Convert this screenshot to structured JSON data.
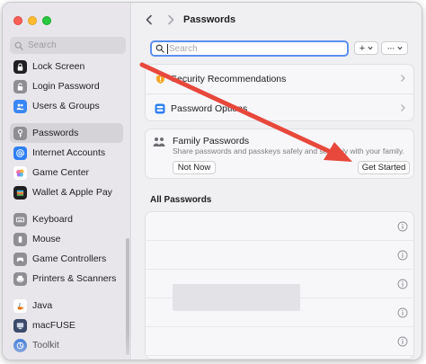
{
  "sidebar": {
    "search_placeholder": "Search",
    "items": [
      {
        "label": "Lock Screen",
        "icon": "lock-icon",
        "color": "#1f1f22"
      },
      {
        "label": "Login Password",
        "icon": "login-password-icon",
        "color": "#8e8e93"
      },
      {
        "label": "Users & Groups",
        "icon": "users-groups-icon",
        "color": "#3a86f5"
      },
      {
        "label": "Passwords",
        "icon": "key-icon",
        "color": "#8e8e93",
        "selected": true
      },
      {
        "label": "Internet Accounts",
        "icon": "at-sign-icon",
        "color": "#2f7ff5"
      },
      {
        "label": "Game Center",
        "icon": "game-center-icon",
        "color": "#f25c9a"
      },
      {
        "label": "Wallet & Apple Pay",
        "icon": "wallet-icon",
        "color": "#1f1f22"
      },
      {
        "label": "Keyboard",
        "icon": "keyboard-icon",
        "color": "#8e8e93"
      },
      {
        "label": "Mouse",
        "icon": "mouse-icon",
        "color": "#8e8e93"
      },
      {
        "label": "Game Controllers",
        "icon": "game-controller-icon",
        "color": "#8e8e93"
      },
      {
        "label": "Printers & Scanners",
        "icon": "printer-icon",
        "color": "#8e8e93"
      },
      {
        "label": "Java",
        "icon": "java-icon",
        "color": "#ffffff"
      },
      {
        "label": "macFUSE",
        "icon": "macfuse-icon",
        "color": "#3b4a6b"
      },
      {
        "label": "Toolkit",
        "icon": "toolkit-icon",
        "color": "#2f6fd6"
      }
    ]
  },
  "toolbar": {
    "back_icon": "chevron-left-icon",
    "forward_icon": "chevron-right-icon",
    "title": "Passwords"
  },
  "search": {
    "placeholder": "Search"
  },
  "actions": {
    "add_label": "+",
    "more_label": "···"
  },
  "rows": {
    "security": "Security Recommendations",
    "options": "Password Options"
  },
  "family": {
    "title": "Family Passwords",
    "description": "Share passwords and passkeys safely and securely with your family.",
    "not_now": "Not Now",
    "get_started": "Get Started"
  },
  "all_passwords": {
    "title": "All Passwords"
  },
  "colors": {
    "accent": "#5a8ef0",
    "arrow": "#e8473b"
  }
}
